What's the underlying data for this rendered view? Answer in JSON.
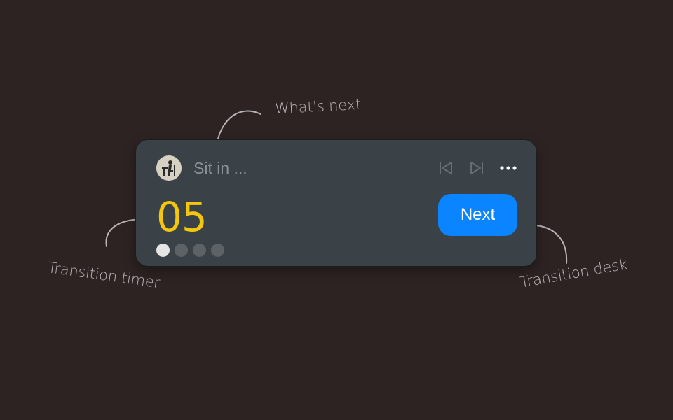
{
  "annotations": {
    "whats_next": "What's next",
    "transition_timer": "Transition timer",
    "transition_desk": "Transition desk"
  },
  "widget": {
    "avatar_icon": "person-at-desk-icon",
    "upcoming_text": "Sit in ...",
    "controls": {
      "previous_icon": "skip-previous-icon",
      "next_icon": "skip-next-icon",
      "more_icon": "more-horizontal-icon"
    },
    "timer_value": "05",
    "progress": {
      "total_steps": 4,
      "current_step": 1
    },
    "next_button_label": "Next"
  },
  "colors": {
    "background": "#2e2323",
    "widget": "#3b4247",
    "timer": "#f4c60c",
    "accent": "#0a84ff"
  }
}
